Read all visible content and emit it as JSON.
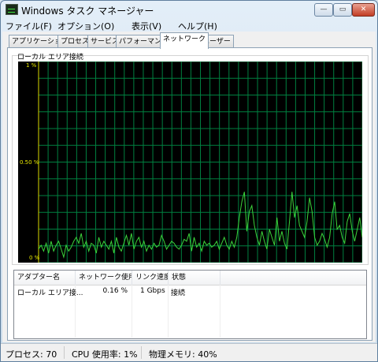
{
  "window": {
    "title": "Windows タスク マネージャー"
  },
  "title_buttons": {
    "min": "—",
    "max": "▭",
    "close": "✕"
  },
  "menu": [
    "ファイル(F)",
    "オプション(O)",
    "表示(V)",
    "ヘルプ(H)"
  ],
  "tabs": [
    "アプリケーション",
    "プロセス",
    "サービス",
    "パフォーマンス",
    "ネットワーク",
    "ユーザー"
  ],
  "active_tab": "ネットワーク",
  "graph": {
    "title": "ローカル エリア接続",
    "y_labels": {
      "top": "1 %",
      "mid": "0.50 %",
      "bottom": "0 %"
    },
    "background": "#000000",
    "grid_color": "#008040",
    "line_color": "#3bd43b",
    "samples_percent": [
      0.06,
      0.08,
      0.05,
      0.09,
      0.04,
      0.1,
      0.05,
      0.08,
      0.1,
      0.06,
      0.02,
      0.08,
      0.05,
      0.07,
      0.1,
      0.12,
      0.09,
      0.14,
      0.07,
      0.1,
      0.05,
      0.09,
      0.08,
      0.04,
      0.12,
      0.07,
      0.1,
      0.08,
      0.06,
      0.1,
      0.04,
      0.12,
      0.07,
      0.05,
      0.09,
      0.13,
      0.08,
      0.14,
      0.06,
      0.1,
      0.12,
      0.07,
      0.1,
      0.05,
      0.08,
      0.06,
      0.09,
      0.07,
      0.08,
      0.13,
      0.1,
      0.06,
      0.08,
      0.1,
      0.09,
      0.07,
      0.06,
      0.08,
      0.11,
      0.1,
      0.14,
      0.05,
      0.12,
      0.07,
      0.09,
      0.05,
      0.1,
      0.08,
      0.09,
      0.07,
      0.08,
      0.1,
      0.06,
      0.09,
      0.12,
      0.08,
      0.06,
      0.1,
      0.07,
      0.12,
      0.22,
      0.3,
      0.35,
      0.15,
      0.25,
      0.28,
      0.18,
      0.12,
      0.08,
      0.15,
      0.1,
      0.06,
      0.16,
      0.12,
      0.08,
      0.22,
      0.1,
      0.15,
      0.09,
      0.06,
      0.2,
      0.35,
      0.22,
      0.28,
      0.18,
      0.15,
      0.12,
      0.2,
      0.32,
      0.25,
      0.12,
      0.08,
      0.1,
      0.14,
      0.11,
      0.07,
      0.12,
      0.24,
      0.3,
      0.16,
      0.18,
      0.12,
      0.09,
      0.2,
      0.24,
      0.15,
      0.1,
      0.16,
      0.22,
      0.12
    ]
  },
  "table": {
    "headers": [
      "アダプター名",
      "ネットワーク使用...",
      "リンク速度",
      "状態"
    ],
    "rows": [
      {
        "name": "ローカル エリア接...",
        "usage": "0.16 %",
        "speed": "1 Gbps",
        "state": "接続"
      }
    ]
  },
  "status": {
    "processes": "プロセス: 70",
    "cpu": "CPU 使用率: 1%",
    "memory": "物理メモリ: 40%"
  }
}
